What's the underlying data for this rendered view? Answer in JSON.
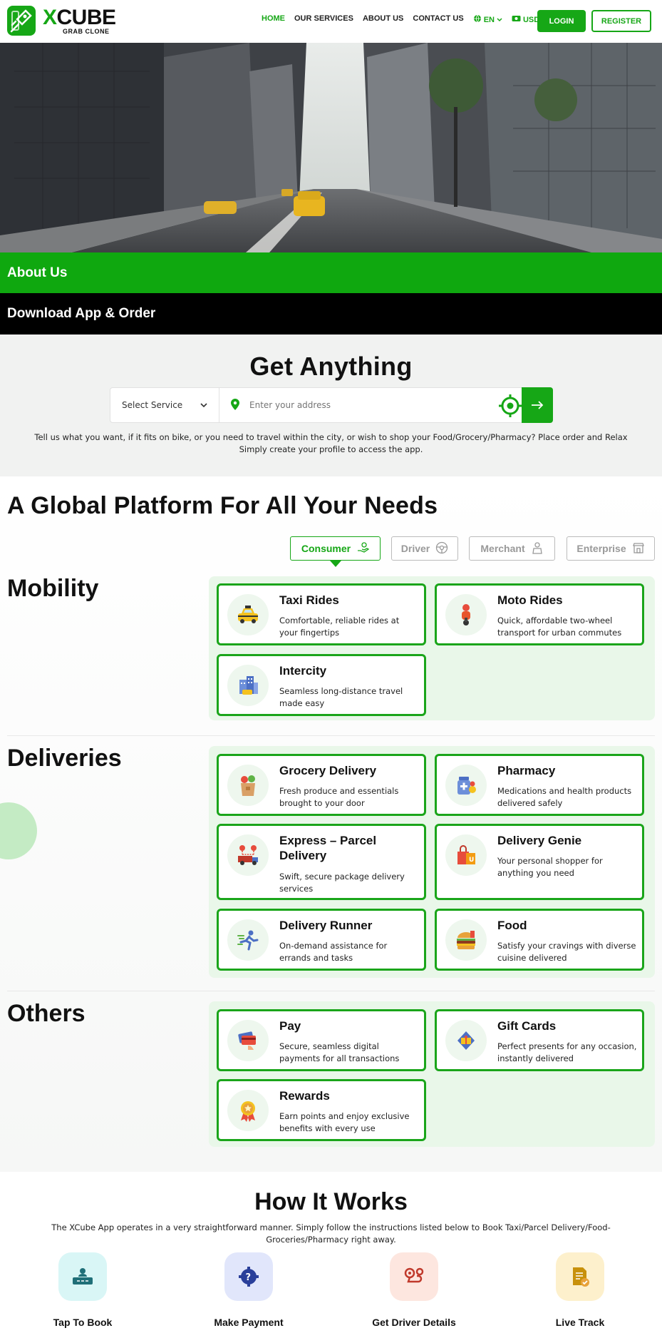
{
  "header": {
    "logo_title_x": "X",
    "logo_title_rest": "CUBE",
    "logo_sub": "GRAB CLONE",
    "nav": [
      "HOME",
      "OUR SERVICES",
      "ABOUT US",
      "CONTACT US"
    ],
    "lang": "EN",
    "currency": "USD",
    "login": "LOGIN",
    "register": "REGISTER"
  },
  "strips": {
    "about": "About Us",
    "download": "Download App & Order"
  },
  "get_anything": {
    "title": "Get Anything",
    "select_service": "Select Service",
    "address_placeholder": "Enter your address",
    "description_line1": "Tell us what you want, if it fits on bike, or you need to travel within the city, or wish to shop your Food/Grocery/Pharmacy? Place order and Relax",
    "description_line2": "Simply create your profile to access the app."
  },
  "platform": {
    "title": "A Global Platform For All Your Needs",
    "tabs": [
      "Consumer",
      "Driver",
      "Merchant",
      "Enterprise"
    ],
    "categories": {
      "mobility": {
        "title": "Mobility",
        "cards": [
          {
            "title": "Taxi Rides",
            "desc": "Comfortable, reliable rides at your fingertips",
            "icon": "taxi-icon"
          },
          {
            "title": "Moto Rides",
            "desc": "Quick, affordable two-wheel transport for urban commutes",
            "icon": "scooter-icon"
          },
          {
            "title": "Intercity",
            "desc": "Seamless long-distance travel made easy",
            "icon": "city-icon"
          }
        ]
      },
      "deliveries": {
        "title": "Deliveries",
        "cards": [
          {
            "title": "Grocery Delivery",
            "desc": "Fresh produce and essentials brought to your door",
            "icon": "grocery-bag-icon"
          },
          {
            "title": "Pharmacy",
            "desc": "Medications and health products delivered safely",
            "icon": "pharmacy-icon"
          },
          {
            "title": "Express – Parcel Delivery",
            "desc": "Swift, secure package delivery services",
            "icon": "parcel-truck-icon"
          },
          {
            "title": "Delivery Genie",
            "desc": "Your personal shopper for anything you need",
            "icon": "shopping-bag-icon"
          },
          {
            "title": "Delivery Runner",
            "desc": "On-demand assistance for errands and tasks",
            "icon": "runner-icon"
          },
          {
            "title": "Food",
            "desc": "Satisfy your cravings with diverse cuisine delivered",
            "icon": "burger-icon"
          }
        ]
      },
      "others": {
        "title": "Others",
        "cards": [
          {
            "title": "Pay",
            "desc": "Secure, seamless digital payments for all transactions",
            "icon": "payment-card-icon"
          },
          {
            "title": "Gift Cards",
            "desc": "Perfect presents for any occasion, instantly delivered",
            "icon": "gift-card-icon"
          },
          {
            "title": "Rewards",
            "desc": "Earn points and enjoy exclusive benefits with every use",
            "icon": "medal-icon"
          }
        ]
      }
    }
  },
  "how_it_works": {
    "title": "How It Works",
    "description": "The XCube App operates in a very straightforward manner. Simply follow the instructions listed below to Book Taxi/Parcel Delivery/Food- Groceries/Pharmacy right away.",
    "steps": [
      {
        "label": "Tap To Book",
        "icon": "tap-book-icon",
        "bg": "#d9f6f6",
        "color": "#1f6f78"
      },
      {
        "label": "Make Payment",
        "icon": "payment-gear-icon",
        "bg": "#e1e6fb",
        "color": "#2a3f9a"
      },
      {
        "label": "Get Driver Details",
        "icon": "route-pin-icon",
        "bg": "#fde6df",
        "color": "#c0392b"
      },
      {
        "label": "Live Track",
        "icon": "document-check-icon",
        "bg": "#fdf0cc",
        "color": "#c8910c"
      }
    ]
  },
  "colors": {
    "brand_green": "#16a716",
    "panel_green": "#e9f7e9"
  }
}
